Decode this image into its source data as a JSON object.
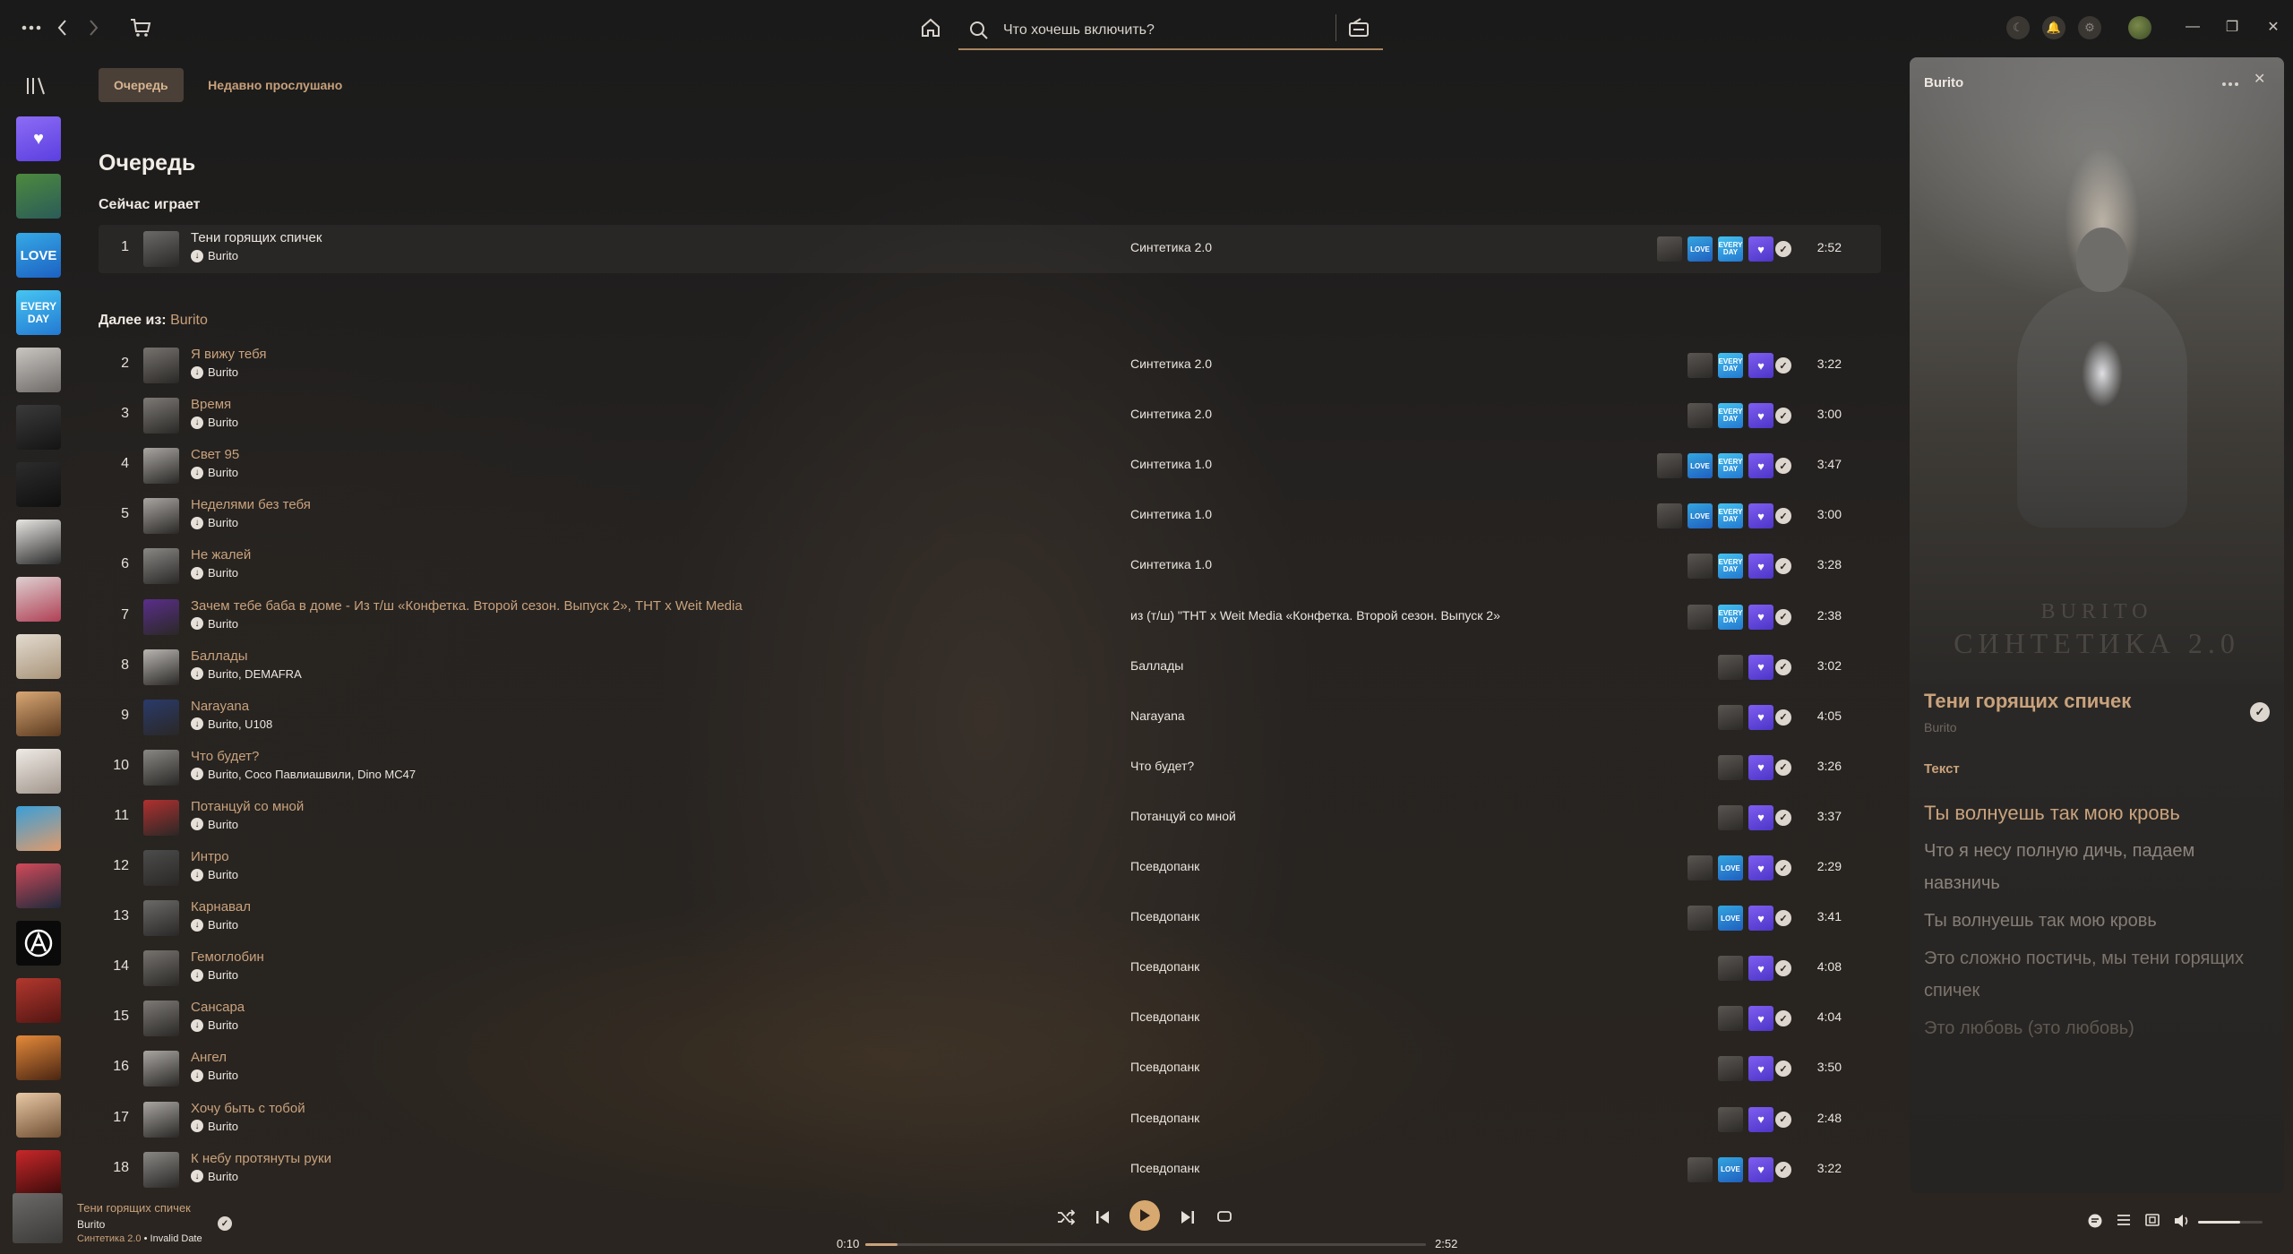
{
  "search": {
    "placeholder": "Что хочешь включить?"
  },
  "tabs": [
    {
      "label": "Очередь",
      "active": true
    },
    {
      "label": "Недавно прослушано",
      "active": false
    }
  ],
  "queue": {
    "title": "Очередь",
    "now_playing_label": "Сейчас играет",
    "next_from_label": "Далее из:",
    "next_from_source": "Burito",
    "current": {
      "num": "1",
      "title": "Тени горящих спичек",
      "artist": "Burito",
      "album": "Синтетика 2.0",
      "duration": "2:52",
      "badges": [
        "art",
        "love",
        "every",
        "heart"
      ]
    },
    "tracks": [
      {
        "num": "2",
        "title": "Я вижу тебя",
        "artist": "Burito",
        "album": "Синтетика 2.0",
        "duration": "3:22",
        "badges": [
          "art",
          "every",
          "heart"
        ]
      },
      {
        "num": "3",
        "title": "Время",
        "artist": "Burito",
        "album": "Синтетика 2.0",
        "duration": "3:00",
        "badges": [
          "art",
          "every",
          "heart"
        ]
      },
      {
        "num": "4",
        "title": "Свет 95",
        "artist": "Burito",
        "album": "Синтетика 1.0",
        "duration": "3:47",
        "badges": [
          "art",
          "love",
          "every",
          "heart"
        ]
      },
      {
        "num": "5",
        "title": "Неделями без тебя",
        "artist": "Burito",
        "album": "Синтетика 1.0",
        "duration": "3:00",
        "badges": [
          "art",
          "love",
          "every",
          "heart"
        ]
      },
      {
        "num": "6",
        "title": "Не жалей",
        "artist": "Burito",
        "album": "Синтетика 1.0",
        "duration": "3:28",
        "badges": [
          "art",
          "every",
          "heart"
        ]
      },
      {
        "num": "7",
        "title": "Зачем тебе баба в доме - Из т/ш «Конфетка. Второй сезон. Выпуск 2», ТНТ x Weit Media",
        "artist": "Burito",
        "album": "из (т/ш) \"ТНТ x Weit Media «Конфетка. Второй сезон. Выпуск 2»",
        "duration": "2:38",
        "badges": [
          "art",
          "every",
          "heart"
        ]
      },
      {
        "num": "8",
        "title": "Баллады",
        "artist": "Burito, DEMAFRA",
        "album": "Баллады",
        "duration": "3:02",
        "badges": [
          "art",
          "heart"
        ]
      },
      {
        "num": "9",
        "title": "Narayana",
        "artist": "Burito, U108",
        "album": "Narayana",
        "duration": "4:05",
        "badges": [
          "art",
          "heart"
        ]
      },
      {
        "num": "10",
        "title": "Что будет?",
        "artist": "Burito, Coco Павлиашвили, Dino MC47",
        "album": "Что будет?",
        "duration": "3:26",
        "badges": [
          "art",
          "heart"
        ]
      },
      {
        "num": "11",
        "title": "Потанцуй со мной",
        "artist": "Burito",
        "album": "Потанцуй со мной",
        "duration": "3:37",
        "badges": [
          "art",
          "heart"
        ]
      },
      {
        "num": "12",
        "title": "Интро",
        "artist": "Burito",
        "album": "Псевдопанк",
        "duration": "2:29",
        "badges": [
          "art",
          "love",
          "heart"
        ]
      },
      {
        "num": "13",
        "title": "Карнавал",
        "artist": "Burito",
        "album": "Псевдопанк",
        "duration": "3:41",
        "badges": [
          "art",
          "love",
          "heart"
        ]
      },
      {
        "num": "14",
        "title": "Гемоглобин",
        "artist": "Burito",
        "album": "Псевдопанк",
        "duration": "4:08",
        "badges": [
          "art",
          "heart"
        ]
      },
      {
        "num": "15",
        "title": "Сансара",
        "artist": "Burito",
        "album": "Псевдопанк",
        "duration": "4:04",
        "badges": [
          "art",
          "heart"
        ]
      },
      {
        "num": "16",
        "title": "Ангел",
        "artist": "Burito",
        "album": "Псевдопанк",
        "duration": "3:50",
        "badges": [
          "art",
          "heart"
        ]
      },
      {
        "num": "17",
        "title": "Хочу быть с тобой",
        "artist": "Burito",
        "album": "Псевдопанк",
        "duration": "2:48",
        "badges": [
          "art",
          "heart"
        ]
      },
      {
        "num": "18",
        "title": "К небу протянуты руки",
        "artist": "Burito",
        "album": "Псевдопанк",
        "duration": "3:22",
        "badges": [
          "art",
          "love",
          "heart"
        ]
      }
    ]
  },
  "badge_text": {
    "love": "LOVE",
    "every": "EVERY DAY",
    "heart": "♥"
  },
  "right_panel": {
    "header": "Burito",
    "art_text_1": "BURITO",
    "art_text_2": "СИНТЕТИКА 2.0",
    "track_title": "Тени горящих спичек",
    "artist": "Burito",
    "lyrics_label": "Текст",
    "lyrics": [
      "Ты волнуешь так мою кровь",
      "Что я несу полную дичь, падаем навзничь",
      "Ты волнуешь так мою кровь",
      "Это сложно постичь, мы тени горящих спичек",
      "Это любовь (это любовь)"
    ]
  },
  "player": {
    "title": "Тени горящих спичек",
    "artist": "Burito",
    "album": "Синтетика 2.0",
    "date_text": "• Invalid Date",
    "elapsed": "0:10",
    "total": "2:52",
    "progress": 0.058,
    "volume": 0.65
  },
  "sidebar": {
    "icons": [
      "library-icon"
    ],
    "items": [
      "liked-tracks",
      "playlist-1",
      "love-playlist",
      "every-day-playlist",
      "artist-1",
      "artist-2",
      "artist-3",
      "artist-4",
      "artist-5",
      "artist-6",
      "artist-7",
      "artist-8",
      "artist-9",
      "artist-10",
      "artist-11",
      "artist-12",
      "artist-13",
      "artist-14",
      "artist-15"
    ]
  }
}
